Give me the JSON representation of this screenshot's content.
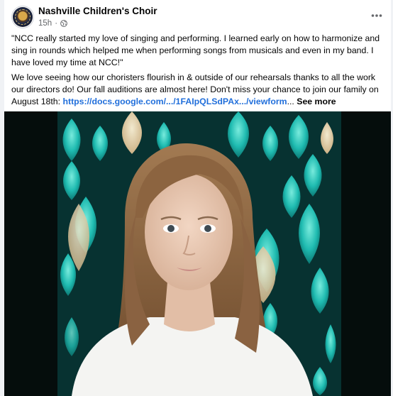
{
  "post": {
    "page_name": "Nashville Children's Choir",
    "time_ago": "15h",
    "separator": "·",
    "quote": "\"NCC really started my love of singing and performing. I learned early on how to harmonize and sing in rounds which helped me when performing songs from musicals and even in my band. I have loved my time at NCC!\"",
    "body_text": "We love seeing how our choristers flourish in & outside of our rehearsals thanks to all the work our directors do! Our fall auditions are almost here! Don't miss your chance to join our family on August 18th: ",
    "link_text": "https://docs.google.com/.../1FAIpQLSdPAx.../viewform",
    "ellipsis": "...",
    "see_more": "See more"
  },
  "icons": {
    "globe": "globe-icon",
    "more": "more-horizontal-icon"
  },
  "colors": {
    "link": "#216fdb",
    "text": "#050505",
    "secondary": "#65676b"
  }
}
